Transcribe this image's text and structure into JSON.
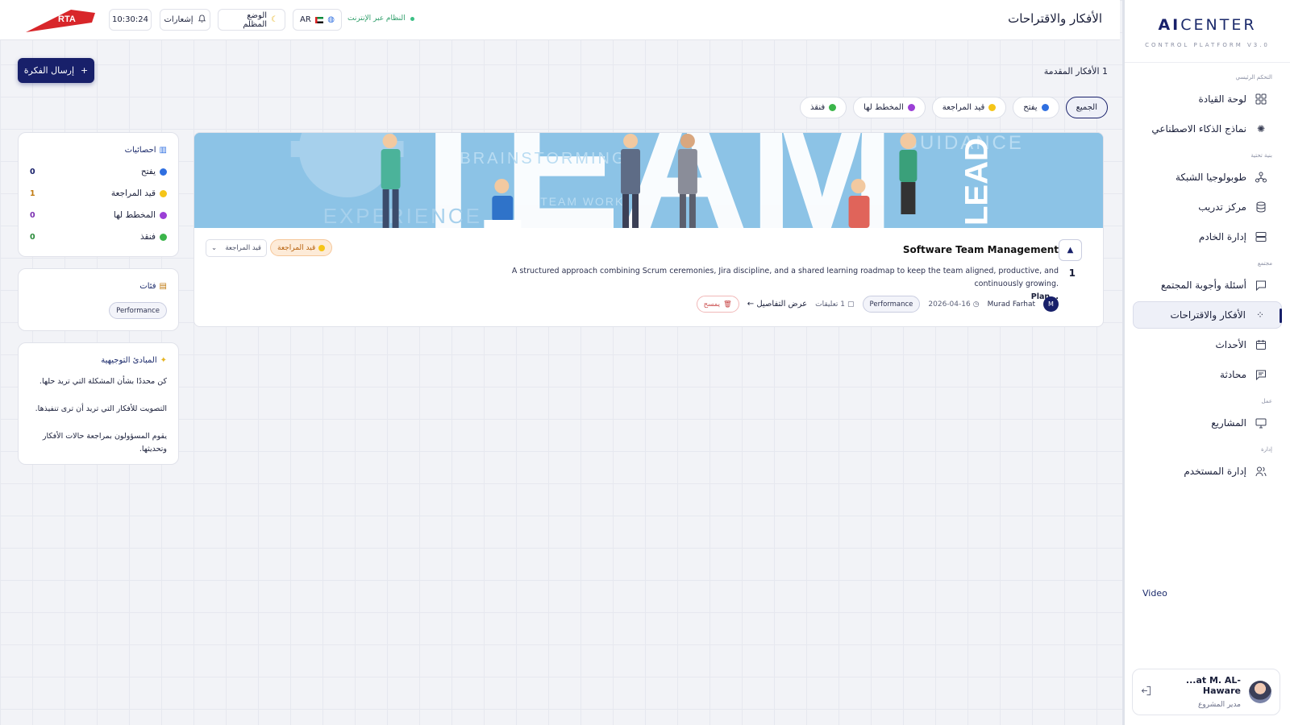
{
  "sidebar": {
    "brand_ai": "AI",
    "brand_center": "CENTER",
    "brand_sub": "CONTROL PLATFORM V3.0",
    "sections": {
      "main": "التحكم الرئيسي",
      "infra": "بنية تحتية",
      "community": "مجتمع",
      "work": "عمل",
      "admin": "إدارة"
    },
    "items": [
      {
        "label": "لوحة القيادة",
        "icon": "grid-icon"
      },
      {
        "label": "نماذج الذكاء الاصطناعي",
        "icon": "sparkle-icon"
      },
      {
        "label": "طوبولوجيا الشبكة",
        "icon": "network-icon"
      },
      {
        "label": "مركز تدريب",
        "icon": "database-icon"
      },
      {
        "label": "إدارة الخادم",
        "icon": "server-icon"
      },
      {
        "label": "أسئلة وأجوبة المجتمع",
        "icon": "chat-icon"
      },
      {
        "label": "الأفكار والاقتراحات",
        "icon": "loader-icon"
      },
      {
        "label": "الأحداث",
        "icon": "calendar-icon"
      },
      {
        "label": "محادثة",
        "icon": "message-icon"
      },
      {
        "label": "المشاريع",
        "icon": "monitor-icon"
      },
      {
        "label": "إدارة المستخدم",
        "icon": "users-icon"
      }
    ],
    "video_link": "Video",
    "user": {
      "name": "...at M. AL-Haware",
      "role": "مدير المشروع"
    }
  },
  "header": {
    "title": "الأفكار والاقتراحات",
    "logo_text": "RTA",
    "time": "10:30:24",
    "notifications": "إشعارات",
    "dark_mode": "الوضع المظلم",
    "lang": "AR",
    "status": "النظام عبر الإنترنت"
  },
  "main": {
    "submit_label": "إرسال الفكرة",
    "count_text": "1 الأفكار المقدمة",
    "filters": [
      {
        "label": "الجميع",
        "color": ""
      },
      {
        "label": "يفتح",
        "color": "#2f6fe0"
      },
      {
        "label": "قيد المراجعة",
        "color": "#f5c518"
      },
      {
        "label": "المخطط لها",
        "color": "#9b3fd6"
      },
      {
        "label": "فنقذ",
        "color": "#3bb54a"
      }
    ],
    "idea": {
      "banner_words": [
        "TEAM",
        "BRAINSTORMING",
        "GUIDANCE",
        "EXPERIENCE",
        "TEAM WORK",
        "LEAD"
      ],
      "votes": "1",
      "title": "Software Team Management",
      "description": "A structured approach combining Scrum ceremonies, Jira discipline, and a shared learning roadmap to keep the team aligned, productive, and continuously growing.",
      "description_more": "Plan...",
      "status": "قيد المراجعة",
      "status_select": "قيد المراجعة",
      "author_initial": "M",
      "author": "Murad Farhat",
      "date": "2026-04-16",
      "tag": "Performance",
      "comments": "1 تعليقات",
      "details": "عرض التفاصيل ←",
      "delete": "يمسح"
    }
  },
  "stats": {
    "title": "احصائيات",
    "rows": [
      {
        "label": "يفتح",
        "value": "0",
        "color": "#2f6fe0",
        "val_color": "#18206a"
      },
      {
        "label": "قيد المراجعة",
        "value": "1",
        "color": "#f5c518",
        "val_color": "#c07a10"
      },
      {
        "label": "المخطط لها",
        "value": "0",
        "color": "#9b3fd6",
        "val_color": "#7b2fb0"
      },
      {
        "label": "فنقذ",
        "value": "0",
        "color": "#3bb54a",
        "val_color": "#2a8a3a"
      }
    ]
  },
  "categories": {
    "title": "فئات",
    "items": [
      "Performance"
    ]
  },
  "principles": {
    "title": "المبادئ التوجيهية",
    "items": [
      "كن محددًا بشأن المشكلة التي تريد حلها.",
      "التصويت للأفكار التي تريد أن ترى تنفيذها.",
      "يقوم المسؤولون بمراجعة حالات الأفكار وتحديثها."
    ]
  },
  "colors": {
    "primary": "#18206a",
    "accent_orange": "#f6c79a",
    "success": "#3bbf84"
  }
}
